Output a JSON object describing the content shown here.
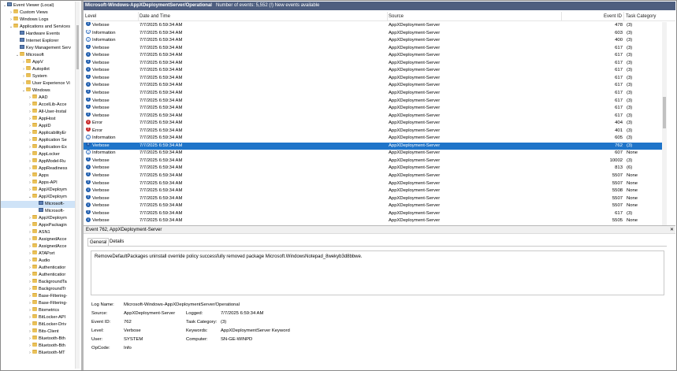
{
  "tree": {
    "items": [
      {
        "label": "Event Viewer (Local)",
        "depth": 0,
        "icon": "pc-icon",
        "expander": "chevron-down"
      },
      {
        "label": "Custom Views",
        "depth": 1,
        "icon": "folder-icon",
        "expander": "chevron-right"
      },
      {
        "label": "Windows Logs",
        "depth": 1,
        "icon": "folder-icon",
        "expander": "chevron-right"
      },
      {
        "label": "Applications and Services",
        "depth": 1,
        "icon": "folder-icon",
        "expander": "chevron-down"
      },
      {
        "label": "Hardware Events",
        "depth": 2,
        "icon": "log-icon",
        "expander": ""
      },
      {
        "label": "Internet Explorer",
        "depth": 2,
        "icon": "log-icon",
        "expander": ""
      },
      {
        "label": "Key Management Serv",
        "depth": 2,
        "icon": "log-icon",
        "expander": ""
      },
      {
        "label": "Microsoft",
        "depth": 2,
        "icon": "folder-icon",
        "expander": "chevron-down"
      },
      {
        "label": "AppV",
        "depth": 3,
        "icon": "folder-icon",
        "expander": "chevron-right"
      },
      {
        "label": "Autopilot",
        "depth": 3,
        "icon": "folder-icon",
        "expander": "chevron-right"
      },
      {
        "label": "System",
        "depth": 3,
        "icon": "folder-icon",
        "expander": "chevron-right"
      },
      {
        "label": "User Experience Vi",
        "depth": 3,
        "icon": "folder-icon",
        "expander": "chevron-right"
      },
      {
        "label": "Windows",
        "depth": 3,
        "icon": "folder-icon",
        "expander": "chevron-down"
      },
      {
        "label": "AAD",
        "depth": 4,
        "icon": "folder-icon",
        "expander": "chevron-right"
      },
      {
        "label": "AccelLib-Acce",
        "depth": 4,
        "icon": "folder-icon",
        "expander": "chevron-right"
      },
      {
        "label": "All-User-Instal",
        "depth": 4,
        "icon": "folder-icon",
        "expander": "chevron-right"
      },
      {
        "label": "AppHost",
        "depth": 4,
        "icon": "folder-icon",
        "expander": "chevron-right"
      },
      {
        "label": "AppID",
        "depth": 4,
        "icon": "folder-icon",
        "expander": "chevron-right"
      },
      {
        "label": "ApplicabilityEr",
        "depth": 4,
        "icon": "folder-icon",
        "expander": "chevron-right"
      },
      {
        "label": "Application Se",
        "depth": 4,
        "icon": "folder-icon",
        "expander": "chevron-right"
      },
      {
        "label": "Application-Ex",
        "depth": 4,
        "icon": "folder-icon",
        "expander": "chevron-right"
      },
      {
        "label": "AppLocker",
        "depth": 4,
        "icon": "folder-icon",
        "expander": "chevron-right"
      },
      {
        "label": "AppModel-Ru",
        "depth": 4,
        "icon": "folder-icon",
        "expander": "chevron-right"
      },
      {
        "label": "AppReadiness",
        "depth": 4,
        "icon": "folder-icon",
        "expander": "chevron-right"
      },
      {
        "label": "Apps",
        "depth": 4,
        "icon": "folder-icon",
        "expander": "chevron-right"
      },
      {
        "label": "Apps-API",
        "depth": 4,
        "icon": "folder-icon",
        "expander": "chevron-right"
      },
      {
        "label": "AppXDeploym",
        "depth": 4,
        "icon": "folder-icon",
        "expander": "chevron-right"
      },
      {
        "label": "AppXDeploym",
        "depth": 4,
        "icon": "folder-icon",
        "expander": "chevron-down"
      },
      {
        "label": "Microsoft-",
        "depth": 5,
        "icon": "log-icon",
        "expander": "",
        "selected": true
      },
      {
        "label": "Microsoft-",
        "depth": 5,
        "icon": "log-icon",
        "expander": ""
      },
      {
        "label": "AppXDeploym",
        "depth": 4,
        "icon": "folder-icon",
        "expander": "chevron-right"
      },
      {
        "label": "AppxPackagin",
        "depth": 4,
        "icon": "folder-icon",
        "expander": "chevron-right"
      },
      {
        "label": "ASN1",
        "depth": 4,
        "icon": "folder-icon",
        "expander": "chevron-right"
      },
      {
        "label": "AssignedAcce",
        "depth": 4,
        "icon": "folder-icon",
        "expander": "chevron-right"
      },
      {
        "label": "AssignedAcce",
        "depth": 4,
        "icon": "folder-icon",
        "expander": "chevron-right"
      },
      {
        "label": "ATAPort",
        "depth": 4,
        "icon": "folder-icon",
        "expander": "chevron-right"
      },
      {
        "label": "Audio",
        "depth": 4,
        "icon": "folder-icon",
        "expander": "chevron-right"
      },
      {
        "label": "Authenticatior",
        "depth": 4,
        "icon": "folder-icon",
        "expander": "chevron-right"
      },
      {
        "label": "Authenticatior",
        "depth": 4,
        "icon": "folder-icon",
        "expander": "chevron-right"
      },
      {
        "label": "BackgroundTa",
        "depth": 4,
        "icon": "folder-icon",
        "expander": "chevron-right"
      },
      {
        "label": "BackgroundTr",
        "depth": 4,
        "icon": "folder-icon",
        "expander": "chevron-right"
      },
      {
        "label": "Base-Filtering-",
        "depth": 4,
        "icon": "folder-icon",
        "expander": "chevron-right"
      },
      {
        "label": "Base-Filtering-",
        "depth": 4,
        "icon": "folder-icon",
        "expander": "chevron-right"
      },
      {
        "label": "Biometrics",
        "depth": 4,
        "icon": "folder-icon",
        "expander": "chevron-right"
      },
      {
        "label": "BitLocker-API",
        "depth": 4,
        "icon": "folder-icon",
        "expander": "chevron-right"
      },
      {
        "label": "BitLocker-Driv",
        "depth": 4,
        "icon": "folder-icon",
        "expander": "chevron-right"
      },
      {
        "label": "Bits-Client",
        "depth": 4,
        "icon": "folder-icon",
        "expander": "chevron-right"
      },
      {
        "label": "Bluetooth-Bth",
        "depth": 4,
        "icon": "folder-icon",
        "expander": "chevron-right"
      },
      {
        "label": "Bluetooth-Bth",
        "depth": 4,
        "icon": "folder-icon",
        "expander": "chevron-right"
      },
      {
        "label": "Bluetooth-MT",
        "depth": 4,
        "icon": "folder-icon",
        "expander": "chevron-right"
      }
    ]
  },
  "header": {
    "log_name": "Microsoft-Windows-AppXDeploymentServer/Operational",
    "summary": "Number of events: 5,552 (!) New events available"
  },
  "table": {
    "columns": {
      "level": "Level",
      "datetime": "Date and Time",
      "source": "Source",
      "event_id": "Event ID",
      "task": "Task Category"
    },
    "rows": [
      {
        "level": "Verbose",
        "icon": "verbose-icon",
        "datetime": "7/7/2025 6:59:34 AM",
        "source": "AppXDeployment-Server",
        "event_id": "478",
        "task": "(3)"
      },
      {
        "level": "Information",
        "icon": "info-icon",
        "datetime": "7/7/2025 6:59:34 AM",
        "source": "AppXDeployment-Server",
        "event_id": "603",
        "task": "(3)"
      },
      {
        "level": "Information",
        "icon": "info-icon",
        "datetime": "7/7/2025 6:59:34 AM",
        "source": "AppXDeployment-Server",
        "event_id": "400",
        "task": "(3)"
      },
      {
        "level": "Verbose",
        "icon": "verbose-icon",
        "datetime": "7/7/2025 6:59:34 AM",
        "source": "AppXDeployment-Server",
        "event_id": "617",
        "task": "(3)"
      },
      {
        "level": "Verbose",
        "icon": "verbose-icon",
        "datetime": "7/7/2025 6:59:34 AM",
        "source": "AppXDeployment-Server",
        "event_id": "617",
        "task": "(3)"
      },
      {
        "level": "Verbose",
        "icon": "verbose-icon",
        "datetime": "7/7/2025 6:59:34 AM",
        "source": "AppXDeployment-Server",
        "event_id": "617",
        "task": "(3)"
      },
      {
        "level": "Verbose",
        "icon": "verbose-icon",
        "datetime": "7/7/2025 6:59:34 AM",
        "source": "AppXDeployment-Server",
        "event_id": "617",
        "task": "(3)"
      },
      {
        "level": "Verbose",
        "icon": "verbose-icon",
        "datetime": "7/7/2025 6:59:34 AM",
        "source": "AppXDeployment-Server",
        "event_id": "617",
        "task": "(3)"
      },
      {
        "level": "Verbose",
        "icon": "verbose-icon",
        "datetime": "7/7/2025 6:59:34 AM",
        "source": "AppXDeployment-Server",
        "event_id": "617",
        "task": "(3)"
      },
      {
        "level": "Verbose",
        "icon": "verbose-icon",
        "datetime": "7/7/2025 6:59:34 AM",
        "source": "AppXDeployment-Server",
        "event_id": "617",
        "task": "(3)"
      },
      {
        "level": "Verbose",
        "icon": "verbose-icon",
        "datetime": "7/7/2025 6:59:34 AM",
        "source": "AppXDeployment-Server",
        "event_id": "617",
        "task": "(3)"
      },
      {
        "level": "Verbose",
        "icon": "verbose-icon",
        "datetime": "7/7/2025 6:59:34 AM",
        "source": "AppXDeployment-Server",
        "event_id": "617",
        "task": "(3)"
      },
      {
        "level": "Verbose",
        "icon": "verbose-icon",
        "datetime": "7/7/2025 6:59:34 AM",
        "source": "AppXDeployment-Server",
        "event_id": "617",
        "task": "(3)"
      },
      {
        "level": "Error",
        "icon": "error-icon",
        "datetime": "7/7/2025 6:59:34 AM",
        "source": "AppXDeployment-Server",
        "event_id": "404",
        "task": "(3)"
      },
      {
        "level": "Error",
        "icon": "error-icon",
        "datetime": "7/7/2025 6:59:34 AM",
        "source": "AppXDeployment-Server",
        "event_id": "401",
        "task": "(3)"
      },
      {
        "level": "Information",
        "icon": "info-icon",
        "datetime": "7/7/2025 6:59:34 AM",
        "source": "AppXDeployment-Server",
        "event_id": "605",
        "task": "(3)"
      },
      {
        "level": "Verbose",
        "icon": "verbose-icon",
        "datetime": "7/7/2025 6:59:34 AM",
        "source": "AppXDeployment-Server",
        "event_id": "762",
        "task": "(3)",
        "selected": true
      },
      {
        "level": "Information",
        "icon": "info-icon",
        "datetime": "7/7/2025 6:59:34 AM",
        "source": "AppXDeployment-Server",
        "event_id": "607",
        "task": "None"
      },
      {
        "level": "Verbose",
        "icon": "verbose-icon",
        "datetime": "7/7/2025 6:59:34 AM",
        "source": "AppXDeployment-Server",
        "event_id": "10002",
        "task": "(3)"
      },
      {
        "level": "Verbose",
        "icon": "verbose-icon",
        "datetime": "7/7/2025 6:59:34 AM",
        "source": "AppXDeployment-Server",
        "event_id": "813",
        "task": "(6)"
      },
      {
        "level": "Verbose",
        "icon": "verbose-icon",
        "datetime": "7/7/2025 6:59:34 AM",
        "source": "AppXDeployment-Server",
        "event_id": "5507",
        "task": "None"
      },
      {
        "level": "Verbose",
        "icon": "verbose-icon",
        "datetime": "7/7/2025 6:59:34 AM",
        "source": "AppXDeployment-Server",
        "event_id": "5507",
        "task": "None"
      },
      {
        "level": "Verbose",
        "icon": "verbose-icon",
        "datetime": "7/7/2025 6:59:34 AM",
        "source": "AppXDeployment-Server",
        "event_id": "5508",
        "task": "None"
      },
      {
        "level": "Verbose",
        "icon": "verbose-icon",
        "datetime": "7/7/2025 6:59:34 AM",
        "source": "AppXDeployment-Server",
        "event_id": "5507",
        "task": "None"
      },
      {
        "level": "Verbose",
        "icon": "verbose-icon",
        "datetime": "7/7/2025 6:59:34 AM",
        "source": "AppXDeployment-Server",
        "event_id": "5507",
        "task": "None"
      },
      {
        "level": "Verbose",
        "icon": "verbose-icon",
        "datetime": "7/7/2025 6:59:34 AM",
        "source": "AppXDeployment-Server",
        "event_id": "617",
        "task": "(3)"
      },
      {
        "level": "Verbose",
        "icon": "verbose-icon",
        "datetime": "7/7/2025 6:59:34 AM",
        "source": "AppXDeployment-Server",
        "event_id": "5505",
        "task": "None"
      }
    ]
  },
  "details": {
    "title": "Event 762, AppXDeployment-Server",
    "close_glyph": "✕",
    "tabs": [
      "General",
      "Details"
    ],
    "message": "RemoveDefaultPackages uninstall override policy successfully removed package Microsoft.WindowsNotepad_8wekyb3d8bbwe.",
    "fields": {
      "log_name_label": "Log Name:",
      "log_name": "Microsoft-Windows-AppXDeploymentServer/Operational",
      "source_label": "Source:",
      "source": "AppXDeployment-Server",
      "logged_label": "Logged:",
      "logged": "7/7/2025 6:59:34 AM",
      "event_id_label": "Event ID:",
      "event_id": "762",
      "task_label": "Task Category:",
      "task": "(3)",
      "level_label": "Level:",
      "level": "Verbose",
      "keywords_label": "Keywords:",
      "keywords": "AppXDeploymentServer Keyword",
      "user_label": "User:",
      "user": "SYSTEM",
      "computer_label": "Computer:",
      "computer": "SN-GE-WINPD",
      "opcode_label": "OpCode:",
      "opcode": "Info"
    }
  },
  "colors": {
    "header_bar": "#4e5e7f",
    "selection": "#1e74c9",
    "verbose_icon": "#1f5dad",
    "error_icon": "#c8282a",
    "folder": "#e9c15a"
  }
}
